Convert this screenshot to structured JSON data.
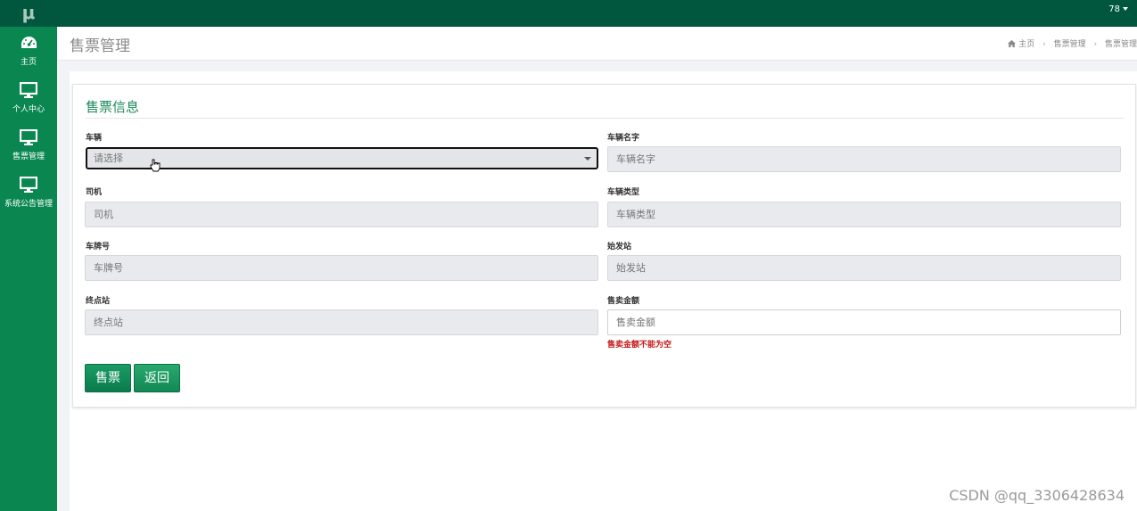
{
  "app": {
    "logo": "μ",
    "user": "78"
  },
  "sidebar": {
    "items": [
      {
        "label": "主页",
        "icon": "dashboard-icon"
      },
      {
        "label": "个人中心",
        "icon": "monitor-icon"
      },
      {
        "label": "售票管理",
        "icon": "monitor-icon"
      },
      {
        "label": "系统公告管理",
        "icon": "monitor-icon"
      }
    ]
  },
  "header": {
    "title": "售票管理",
    "breadcrumb": [
      "主页",
      "售票管理",
      "售票管理"
    ]
  },
  "form": {
    "title": "售票信息",
    "fields": {
      "vehicle": {
        "label": "车辆",
        "placeholder": "请选择"
      },
      "vehicle_name": {
        "label": "车辆名字",
        "placeholder": "车辆名字"
      },
      "driver": {
        "label": "司机",
        "placeholder": "司机"
      },
      "vehicle_type": {
        "label": "车辆类型",
        "placeholder": "车辆类型"
      },
      "plate": {
        "label": "车牌号",
        "placeholder": "车牌号"
      },
      "origin": {
        "label": "始发站",
        "placeholder": "始发站"
      },
      "destination": {
        "label": "终点站",
        "placeholder": "终点站"
      },
      "amount": {
        "label": "售卖金额",
        "placeholder": "售卖金额",
        "error": "售卖金额不能为空"
      }
    },
    "buttons": {
      "submit": "售票",
      "back": "返回"
    }
  },
  "watermark": "CSDN @qq_3306428634",
  "colors": {
    "topbar": "#00573d",
    "sidebar": "#0a8750",
    "accent": "#1b8a5a",
    "error": "#c41a1a"
  }
}
